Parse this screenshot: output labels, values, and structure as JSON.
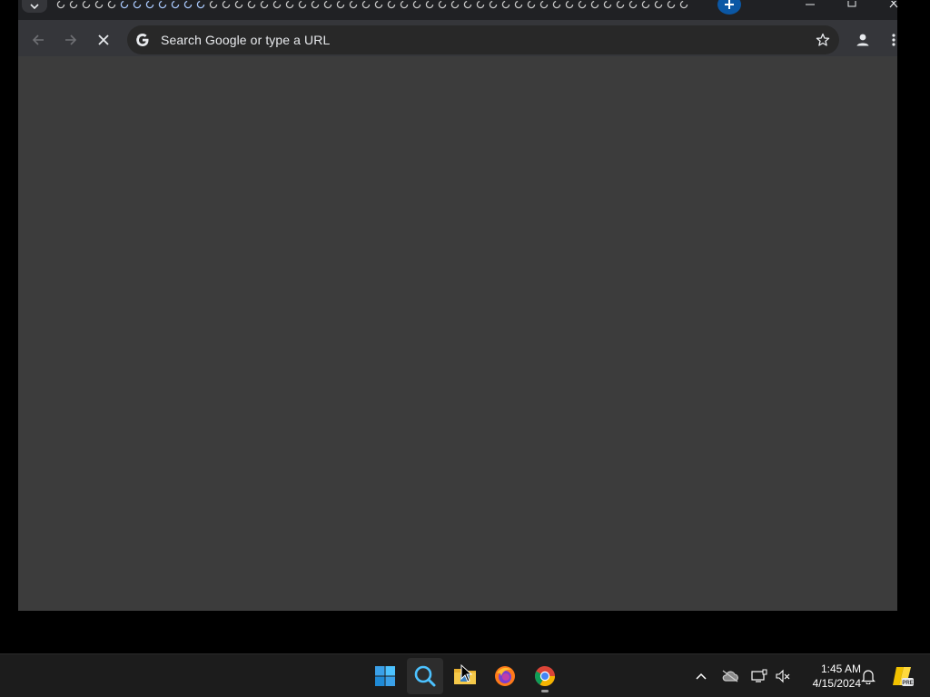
{
  "window": {
    "omnibox_placeholder": "Search Google or type a URL"
  },
  "taskbar": {
    "apps": [
      {
        "name": "start-button"
      },
      {
        "name": "search"
      },
      {
        "name": "file-explorer"
      },
      {
        "name": "firefox"
      },
      {
        "name": "chrome"
      }
    ],
    "clock": {
      "time": "1:45 AM",
      "date": "4/15/2024"
    }
  },
  "colors": {
    "accent_blue": "#0b57a4",
    "toolbar": "#35363a",
    "content_bg": "#3c3c3c",
    "taskbar": "#1c1c1c"
  }
}
